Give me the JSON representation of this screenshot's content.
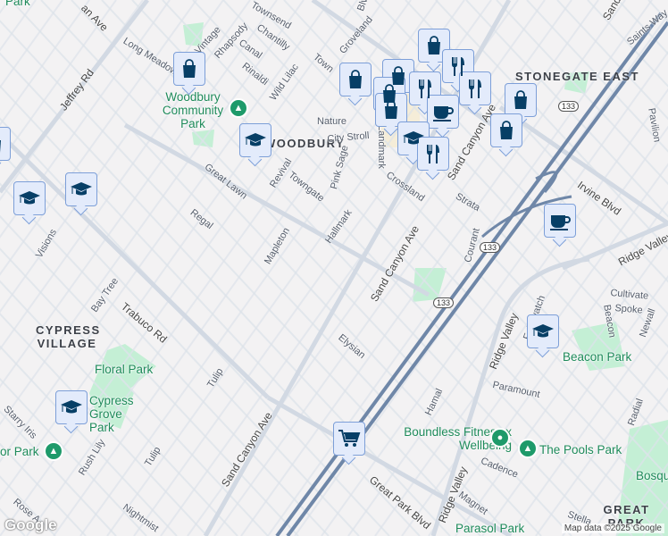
{
  "neighborhoods": {
    "woodbury": "WOODBURY",
    "stonegate": "STONEGATE EAST",
    "cypress": "CYPRESS VILLAGE",
    "greatpark": "GREAT PARK"
  },
  "parks": {
    "woodbury": "Woodbury Community Park",
    "floral": "Floral Park",
    "cypress": "Cypress Grove Park",
    "harbor": "or Park",
    "beacon": "Beacon Park",
    "pools": "The Pools Park",
    "boundless": "Boundless Fitness x Wellbeing",
    "bosque": "Bosqu",
    "park_top": "Park",
    "parasol": "Parasol Park"
  },
  "streets": {
    "jeffrey": "Jeffrey Rd",
    "trabuco": "Trabuco Rd",
    "sandcanyon1": "Sand Canyon Ave",
    "sandcanyon2": "Sand Canyon Ave",
    "sandcanyon3": "Sand Canyon Ave",
    "sandtop": "Sand",
    "irvine": "Irvine Blvd",
    "ridge1": "Ridge Valley",
    "ridge2": "Ridge Valley",
    "ridge3": "Ridge Valley",
    "greatparkblvd": "Great Park Blvd",
    "longmeadow": "Long Meadow",
    "vintage": "Vintage",
    "rhapsody": "Rhapsody",
    "canal": "Canal",
    "chantilly": "Chantilly",
    "townsend": "Townsend",
    "rinaldi": "Rinaldi",
    "wildlilac": "Wild Lilac",
    "groveland": "Groveland",
    "nature": "Nature",
    "citystroll": "City Stroll",
    "landmark": "Landmark",
    "pinksage": "Pink Sage",
    "towngate": "Towngate",
    "revival": "Revival",
    "greatlawn": "Great Lawn",
    "regal": "Regal",
    "mapleton": "Mapleton",
    "hallmark": "Hallmark",
    "crossland": "Crossland",
    "strata": "Strata",
    "courant": "Courant",
    "saintsway": "Saints Way",
    "visions": "Visions",
    "baytree": "Bay Tree",
    "tulip1": "Tulip",
    "tulip2": "Tulip",
    "starryiris": "Starry Iris",
    "rushlily": "Rush Lily",
    "nightmist": "Nightmist",
    "rose": "Rose A",
    "elysian": "Elysian",
    "hamal": "Hamal",
    "paramount": "Paramount",
    "cadence": "Cadence",
    "magnet": "Magnet",
    "cultivate": "Cultivate",
    "spoke": "Spoke",
    "beacon": "Beacon",
    "newall": "Newall",
    "radial": "Radial",
    "follywatch": "Follywatch",
    "stella": "Stella",
    "pavilion": "Pavilion",
    "blvd_top": "Blvd",
    "ave_top": "an Ave",
    "to_left": "Town"
  },
  "highway": {
    "route": "133"
  },
  "markers": [
    {
      "type": "shopping"
    },
    {
      "type": "school"
    },
    {
      "type": "school"
    },
    {
      "type": "school"
    },
    {
      "type": "school"
    },
    {
      "type": "school"
    },
    {
      "type": "grocery"
    },
    {
      "type": "cafe"
    },
    {
      "type": "shopping"
    },
    {
      "type": "shopping"
    },
    {
      "type": "restaurant"
    },
    {
      "type": "restaurant"
    },
    {
      "type": "shopping"
    },
    {
      "type": "shopping"
    },
    {
      "type": "shopping"
    },
    {
      "type": "shopping"
    },
    {
      "type": "shopping"
    },
    {
      "type": "restaurant"
    },
    {
      "type": "cafe"
    },
    {
      "type": "school"
    },
    {
      "type": "restaurant"
    },
    {
      "type": "shopping"
    }
  ],
  "attribution": {
    "logo": "Google",
    "credit": "Map data ©2025 Google"
  },
  "colors": {
    "background": "#f3f2f3",
    "road": "#d5dce6",
    "highway": "#6f87a8",
    "park": "#c4efd5",
    "marker_icon": "#073f66"
  }
}
